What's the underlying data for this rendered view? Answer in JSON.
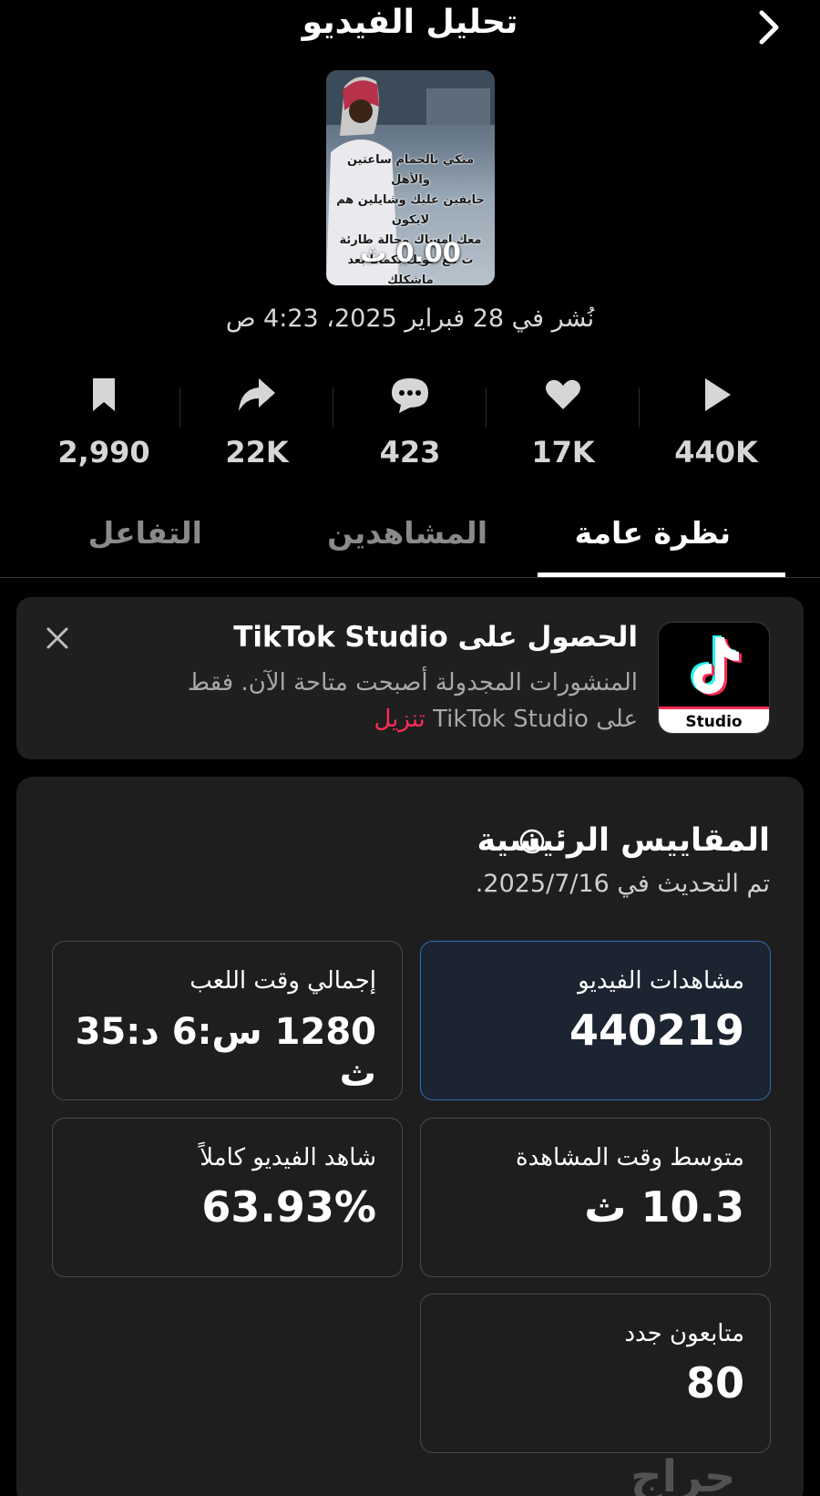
{
  "header": {
    "title": "تحليل الفيديو",
    "back_icon": "chevron-icon"
  },
  "video": {
    "caption_lines": [
      "متكي بالحمام ساعتين والأهل",
      "خايفين عليك وشايلين هم لايكون",
      "معك إمساك وحالة طارئة",
      "",
      "ت مع خويك بكمانا بعد ماشكلك"
    ],
    "duration": "0.00 ث",
    "published": "نُشر في 28 فبراير 2025، 4:23 ص"
  },
  "stats": [
    {
      "icon": "play-icon",
      "value": "440K"
    },
    {
      "icon": "heart-icon",
      "value": "17K"
    },
    {
      "icon": "comment-icon",
      "value": "423"
    },
    {
      "icon": "share-icon",
      "value": "22K"
    },
    {
      "icon": "bookmark-icon",
      "value": "2,990"
    }
  ],
  "tabs": [
    {
      "label": "نظرة عامة",
      "active": true
    },
    {
      "label": "المشاهدين",
      "active": false
    },
    {
      "label": "التفاعل",
      "active": false
    }
  ],
  "promo": {
    "title": "الحصول على TikTok Studio",
    "body": "المنشورات المجدولة أصبحت متاحة الآن. فقط على TikTok Studio",
    "download_label": "تنزيل",
    "app_label": "Studio",
    "close_icon": "close-icon"
  },
  "metrics": {
    "title": "المقاييس الرئيسية",
    "updated": "تم التحديث في 2025/7/16.",
    "cards": {
      "views": {
        "label": "مشاهدات الفيديو",
        "value": "440219"
      },
      "playtime": {
        "label": "إجمالي وقت اللعب",
        "value": "1280 س:6 د:35 ث"
      },
      "avg": {
        "label": "متوسط وقت المشاهدة",
        "value": "10.3 ث"
      },
      "full": {
        "label": "شاهد الفيديو كاملاً",
        "value": "63.93%"
      },
      "followers": {
        "label": "متابعون جدد",
        "value": "80"
      }
    }
  },
  "watermark": "حراج",
  "colors": {
    "background": "#000000",
    "card": "#1e1e1e",
    "highlight_border": "#2e6fb8",
    "tiktok_red": "#fe2c55",
    "tiktok_cyan": "#25f4ee"
  }
}
